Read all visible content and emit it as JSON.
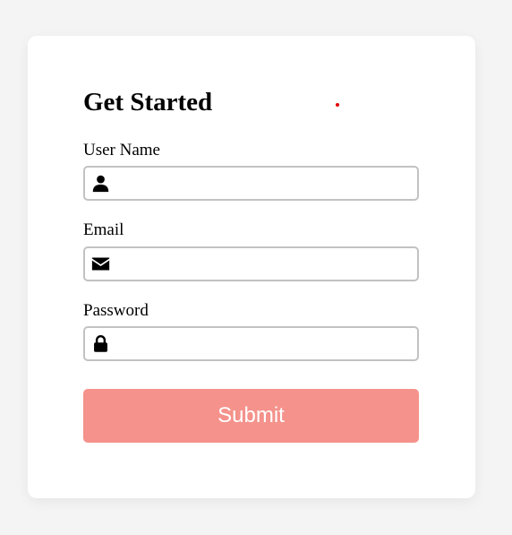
{
  "form": {
    "title": "Get Started",
    "fields": [
      {
        "label": "User Name",
        "icon": "user-icon",
        "value": "",
        "placeholder": ""
      },
      {
        "label": "Email",
        "icon": "envelope-icon",
        "value": "",
        "placeholder": ""
      },
      {
        "label": "Password",
        "icon": "lock-icon",
        "value": "",
        "placeholder": ""
      }
    ],
    "submit_label": "Submit"
  },
  "colors": {
    "background": "#f4f4f4",
    "card": "#ffffff",
    "submit_button": "#f4928b",
    "field_border": "#c2c2c2",
    "dot": "#e00000"
  }
}
